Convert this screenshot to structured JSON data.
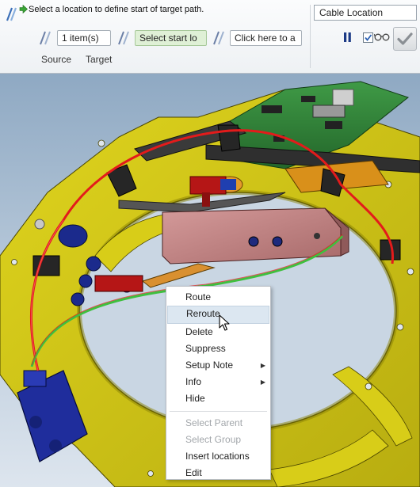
{
  "dashboard": {
    "prompt": "Select a location to define start of target path.",
    "cable_location": "Cable Location",
    "source_value": "1 item(s)",
    "start_value": "Select start lo",
    "add_value": "Click here to a",
    "tabs": [
      "Source",
      "Target"
    ],
    "checkbox_checked": true,
    "accent_green": "#dff0d6"
  },
  "context_menu": {
    "items": [
      {
        "label": "Route",
        "enabled": true
      },
      {
        "label": "Reroute",
        "enabled": true,
        "highlighted": true
      },
      {
        "label": "Delete",
        "enabled": true
      },
      {
        "label": "Suppress",
        "enabled": true
      },
      {
        "label": "Setup Note",
        "enabled": true,
        "submenu": true
      },
      {
        "label": "Info",
        "enabled": true,
        "submenu": true
      },
      {
        "label": "Hide",
        "enabled": true
      },
      {
        "label": "Select Parent",
        "enabled": false
      },
      {
        "label": "Select Group",
        "enabled": false
      },
      {
        "label": "Insert locations",
        "enabled": true
      },
      {
        "label": "Edit",
        "enabled": true
      }
    ]
  },
  "model_colors": {
    "plate": "#cfc313",
    "cable_main": "#e31b1b",
    "cable_route": "#3fbf3f",
    "connector": "#1f2b8f",
    "housing": "#c78686",
    "pcb": "#2f7a36"
  }
}
